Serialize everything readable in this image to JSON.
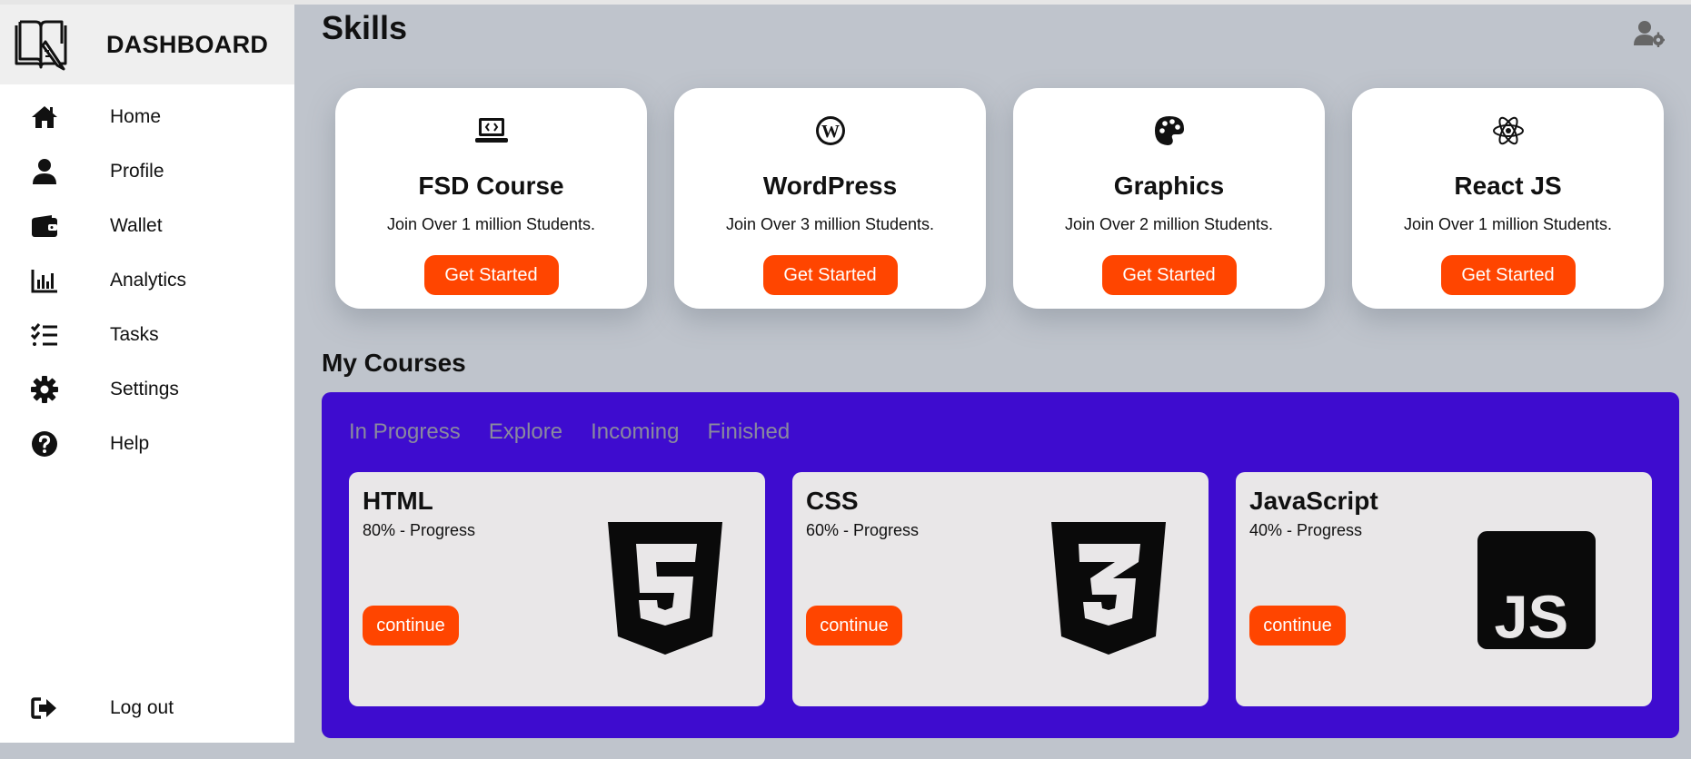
{
  "sidebar": {
    "brand": "DASHBOARD",
    "items": [
      {
        "label": "Home",
        "icon": "home-icon"
      },
      {
        "label": "Profile",
        "icon": "user-icon"
      },
      {
        "label": "Wallet",
        "icon": "wallet-icon"
      },
      {
        "label": "Analytics",
        "icon": "bar-chart-icon"
      },
      {
        "label": "Tasks",
        "icon": "checklist-icon"
      },
      {
        "label": "Settings",
        "icon": "gear-icon"
      },
      {
        "label": "Help",
        "icon": "help-icon"
      }
    ],
    "logout": "Log out"
  },
  "header": {
    "title": "Skills",
    "user_settings_icon": "user-gear-icon"
  },
  "skills": [
    {
      "title": "FSD Course",
      "subtitle": "Join Over 1 million Students.",
      "button": "Get Started",
      "icon": "laptop-code-icon"
    },
    {
      "title": "WordPress",
      "subtitle": "Join Over 3 million Students.",
      "button": "Get Started",
      "icon": "wordpress-icon"
    },
    {
      "title": "Graphics",
      "subtitle": "Join Over 2 million Students.",
      "button": "Get Started",
      "icon": "palette-icon"
    },
    {
      "title": "React JS",
      "subtitle": "Join Over 1 million Students.",
      "button": "Get Started",
      "icon": "react-icon"
    }
  ],
  "my_courses": {
    "title": "My Courses",
    "tabs": [
      "In Progress",
      "Explore",
      "Incoming",
      "Finished"
    ],
    "courses": [
      {
        "title": "HTML",
        "progress": "80% - Progress",
        "progress_value": 80,
        "button": "continue",
        "icon": "html5-icon"
      },
      {
        "title": "CSS",
        "progress": "60% - Progress",
        "progress_value": 60,
        "button": "continue",
        "icon": "css3-icon"
      },
      {
        "title": "JavaScript",
        "progress": "40% - Progress",
        "progress_value": 40,
        "button": "continue",
        "icon": "javascript-icon"
      }
    ]
  },
  "colors": {
    "accent": "#ff4500",
    "courses_panel": "#3e0ccf",
    "background": "#bfc4cc",
    "card": "#ffffff",
    "course_card": "#e9e7e8",
    "tab_text": "#8a8a9e"
  }
}
